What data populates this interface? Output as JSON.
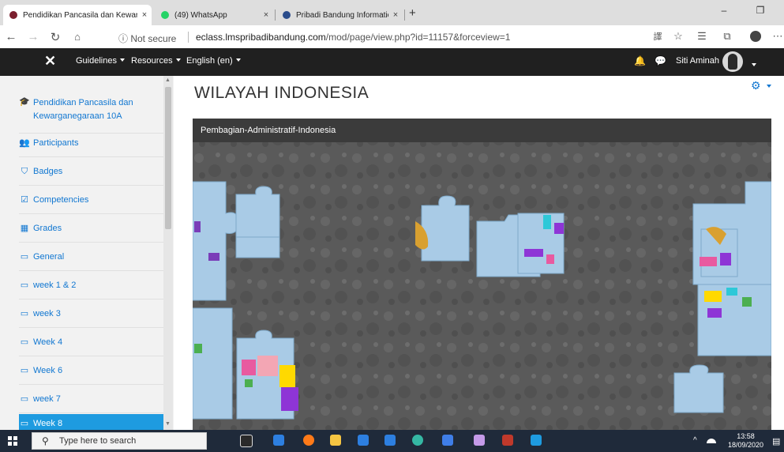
{
  "browser": {
    "tabs": [
      {
        "title": "Pendidikan Pancasila dan Kewarg",
        "active": true,
        "favicon_color": "#7b1f2e"
      },
      {
        "title": "(49) WhatsApp",
        "active": false,
        "favicon_color": "#25d366"
      },
      {
        "title": "Pribadi Bandung Information Sy",
        "active": false,
        "favicon_color": "#2b4d8c"
      }
    ],
    "new_tab": "+",
    "close_glyph": "×",
    "window_controls": [
      "–",
      "❐"
    ],
    "security_label": "ⓘ Not secure",
    "url_domain": "eclass.lmspribadibandung.com",
    "url_path": "/mod/page/view.php?id=11157&forceview=1",
    "nav_icons": [
      "back-icon",
      "forward-icon",
      "refresh-icon",
      "home-icon"
    ]
  },
  "navbar": {
    "close_glyph": "✕",
    "menus": [
      "Guidelines",
      "Resources",
      "English (en)"
    ],
    "user_name": "Siti Aminah",
    "icons": [
      "bell-icon",
      "chat-icon"
    ]
  },
  "drawer": {
    "items": [
      {
        "label": "Pendidikan Pancasila dan Kewarganegaraan 10A",
        "icon": "graduation-cap-icon",
        "glyph": "🎓"
      },
      {
        "label": "Participants",
        "icon": "users-icon",
        "glyph": "👥"
      },
      {
        "label": "Badges",
        "icon": "shield-icon",
        "glyph": "⛉"
      },
      {
        "label": "Competencies",
        "icon": "checkbox-icon",
        "glyph": "☑"
      },
      {
        "label": "Grades",
        "icon": "table-icon",
        "glyph": "▦"
      },
      {
        "label": "General",
        "icon": "folder-icon",
        "glyph": "▭"
      },
      {
        "label": "week 1 & 2",
        "icon": "folder-icon",
        "glyph": "▭"
      },
      {
        "label": "week 3",
        "icon": "folder-icon",
        "glyph": "▭"
      },
      {
        "label": "Week 4",
        "icon": "folder-icon",
        "glyph": "▭"
      },
      {
        "label": "Week 6",
        "icon": "folder-icon",
        "glyph": "▭"
      },
      {
        "label": "week 7",
        "icon": "folder-icon",
        "glyph": "▭"
      },
      {
        "label": "Week 8",
        "icon": "folder-icon",
        "glyph": "▭",
        "active": true
      }
    ]
  },
  "main": {
    "title": "WILAYAH INDONESIA",
    "embed_title": "Pembagian-Administratif-Indonesia"
  },
  "taskbar": {
    "search_placeholder": "Type here to search",
    "time": "13:58",
    "date": "18/09/2020"
  },
  "colors": {
    "accent": "#1177d1",
    "active_item": "#1e9be0",
    "navbar": "#202020",
    "puzzle_piece": "#a9cbe6"
  }
}
